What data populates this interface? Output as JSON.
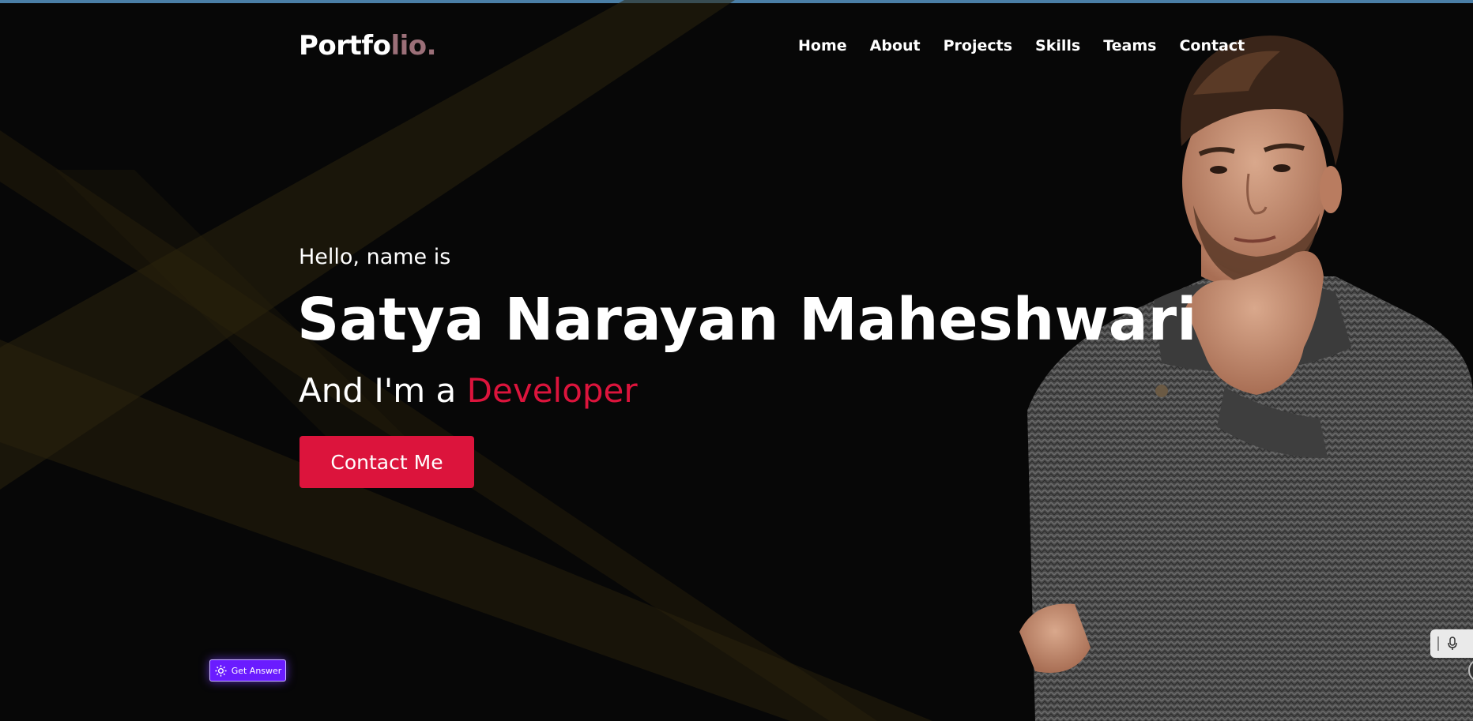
{
  "header": {
    "logo_main": "Portfo",
    "logo_accent": "lio."
  },
  "nav": {
    "items": [
      "Home",
      "About",
      "Projects",
      "Skills",
      "Teams",
      "Contact"
    ]
  },
  "hero": {
    "greeting": "Hello, name is",
    "name": "Satya Narayan Maheshwari",
    "role_prefix": "And I'm a ",
    "role_highlight": "Developer",
    "cta_label": "Contact Me"
  },
  "widgets": {
    "get_answer_label": "Get Answer"
  },
  "colors": {
    "background": "#070707",
    "accent": "#dc143c",
    "logo_accent": "#9b6f78",
    "widget_purple": "#6a1cff"
  },
  "icons": [
    "gear-icon",
    "microphone-icon"
  ]
}
